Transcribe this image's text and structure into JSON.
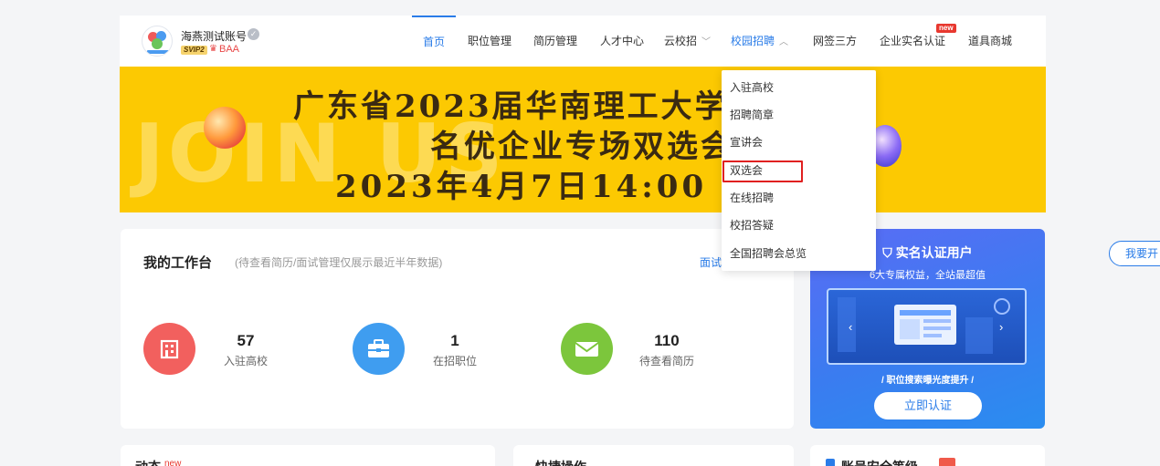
{
  "header": {
    "account_name": "海燕测试账号",
    "vip_badge": "SVIP2",
    "level_text": "BAA",
    "nav": [
      {
        "label": "首页",
        "state": "active"
      },
      {
        "label": "职位管理",
        "state": "normal"
      },
      {
        "label": "简历管理",
        "state": "normal"
      },
      {
        "label": "人才中心",
        "state": "normal"
      },
      {
        "label": "云校招",
        "state": "dropdown"
      },
      {
        "label": "校园招聘",
        "state": "open"
      },
      {
        "label": "网签三方",
        "state": "normal"
      },
      {
        "label": "企业实名认证",
        "state": "normal"
      },
      {
        "label": "道具商城",
        "state": "normal"
      }
    ],
    "new_badge": "new"
  },
  "banner": {
    "line1": "广东省2023届华南理工大学",
    "line2": "名优企业专场双选会",
    "line3": "2023年4月7日14:00 -",
    "watermark": "JOIN US"
  },
  "dropdown": {
    "items": [
      "入驻高校",
      "招聘简章",
      "宣讲会",
      "双选会",
      "在线招聘",
      "校招答疑",
      "全国招聘会总览"
    ],
    "highlighted": "双选会"
  },
  "workbench": {
    "title": "我的工作台",
    "subtitle": "(待查看简历/面试管理仅展示最近半年数据)",
    "link": "面试",
    "stats": [
      {
        "value": "57",
        "label": "入驻高校",
        "color": "#f2605e",
        "icon": "building-icon"
      },
      {
        "value": "1",
        "label": "在招职位",
        "color": "#3f9df0",
        "icon": "briefcase-icon"
      },
      {
        "value": "110",
        "label": "待查看简历",
        "color": "#7cc63c",
        "icon": "mail-icon"
      }
    ]
  },
  "promo": {
    "title": "实名认证用户",
    "subtitle": "6大专属权益，全站最超值",
    "caption": "/ 职位搜索曝光度提升 /",
    "button": "立即认证"
  },
  "side_button": "我要开",
  "bottom": {
    "card1_title": "动态",
    "card1_badge": "new",
    "card2_title": "快捷操作",
    "card3_title": "账号安全等级"
  },
  "colors": {
    "accent": "#2a7ce8",
    "banner": "#fcc902",
    "highlight": "#e02020"
  }
}
